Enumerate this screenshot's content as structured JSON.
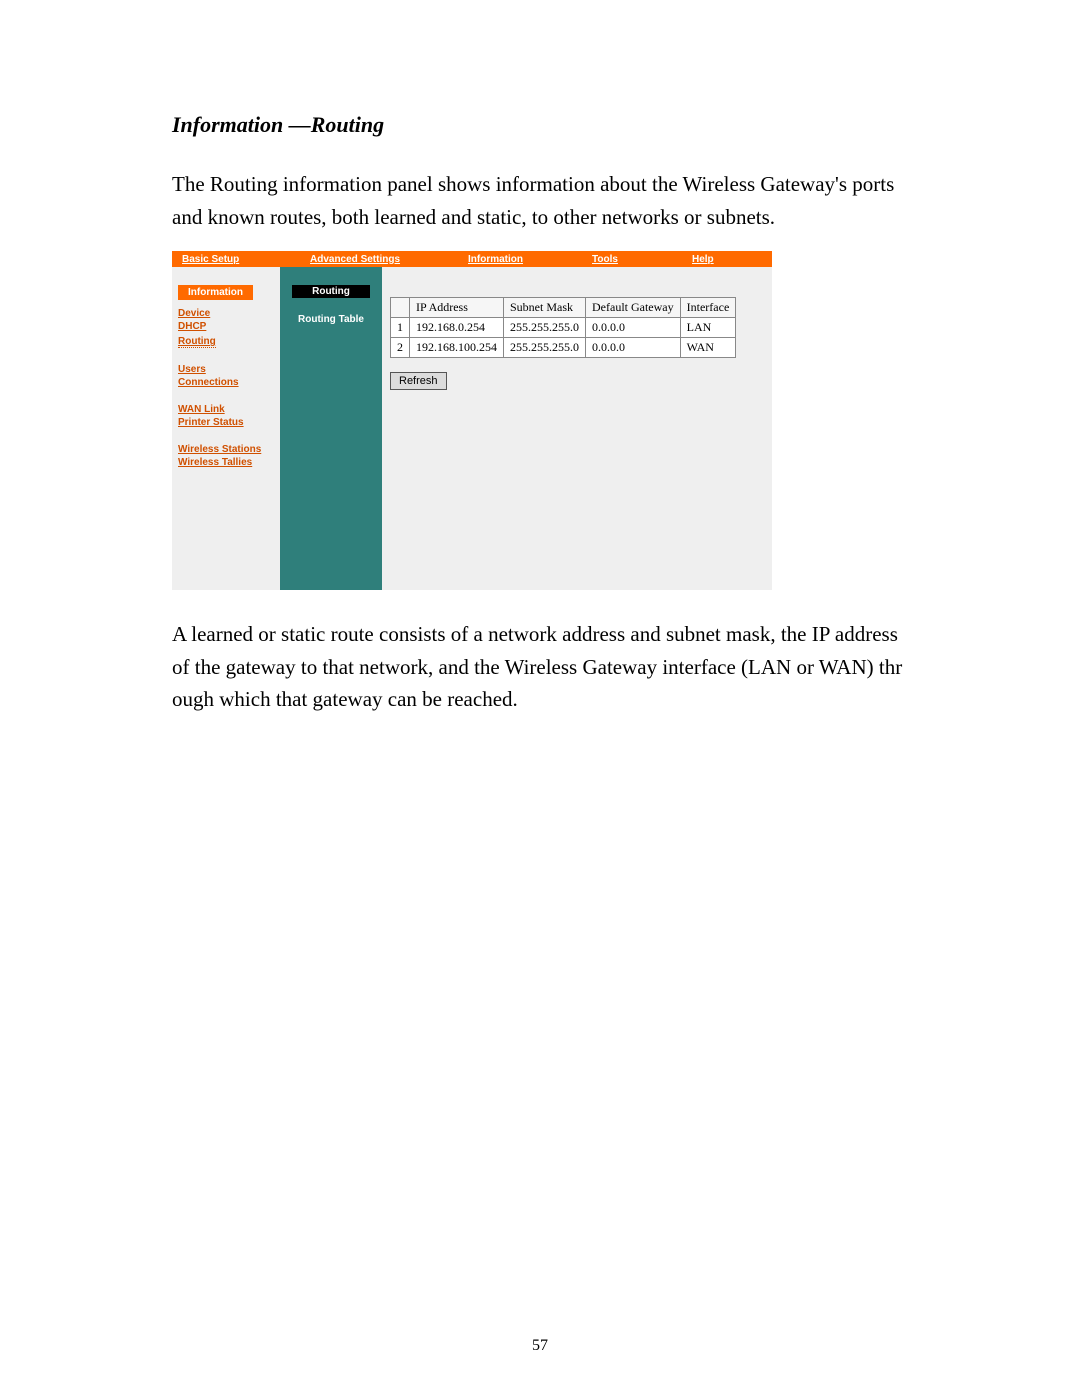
{
  "heading": "Information  —Routing",
  "para1": "The Routing information panel shows information about the Wireless Gateway's ports and known routes, both learned and static, to other networks or subnets.",
  "para2": "A learned or static route consists of a network address and subnet mask, the IP address of the gateway to that network, and the Wireless Gateway interface (LAN or WAN) thr ough which that gateway can be reached.",
  "page_number": "57",
  "topnav": {
    "basic": "Basic Setup",
    "advanced": "Advanced Settings",
    "information": "Information",
    "tools": "Tools",
    "help": "Help"
  },
  "sidebar": {
    "header": "Information",
    "device": "Device",
    "dhcp": "DHCP",
    "routing": "Routing",
    "users": "Users",
    "connections": "Connections",
    "wan_link": "WAN Link",
    "printer_status": "Printer Status",
    "wireless_stations": "Wireless Stations",
    "wireless_tallies": "Wireless Tallies"
  },
  "mid": {
    "title": "Routing",
    "subtitle": "Routing Table"
  },
  "table": {
    "headers": {
      "ip": "IP Address",
      "mask": "Subnet Mask",
      "gw": "Default Gateway",
      "iface": "Interface"
    },
    "rows": [
      {
        "n": "1",
        "ip": "192.168.0.254",
        "mask": "255.255.255.0",
        "gw": "0.0.0.0",
        "iface": "LAN"
      },
      {
        "n": "2",
        "ip": "192.168.100.254",
        "mask": "255.255.255.0",
        "gw": "0.0.0.0",
        "iface": "WAN"
      }
    ]
  },
  "refresh": "Refresh"
}
